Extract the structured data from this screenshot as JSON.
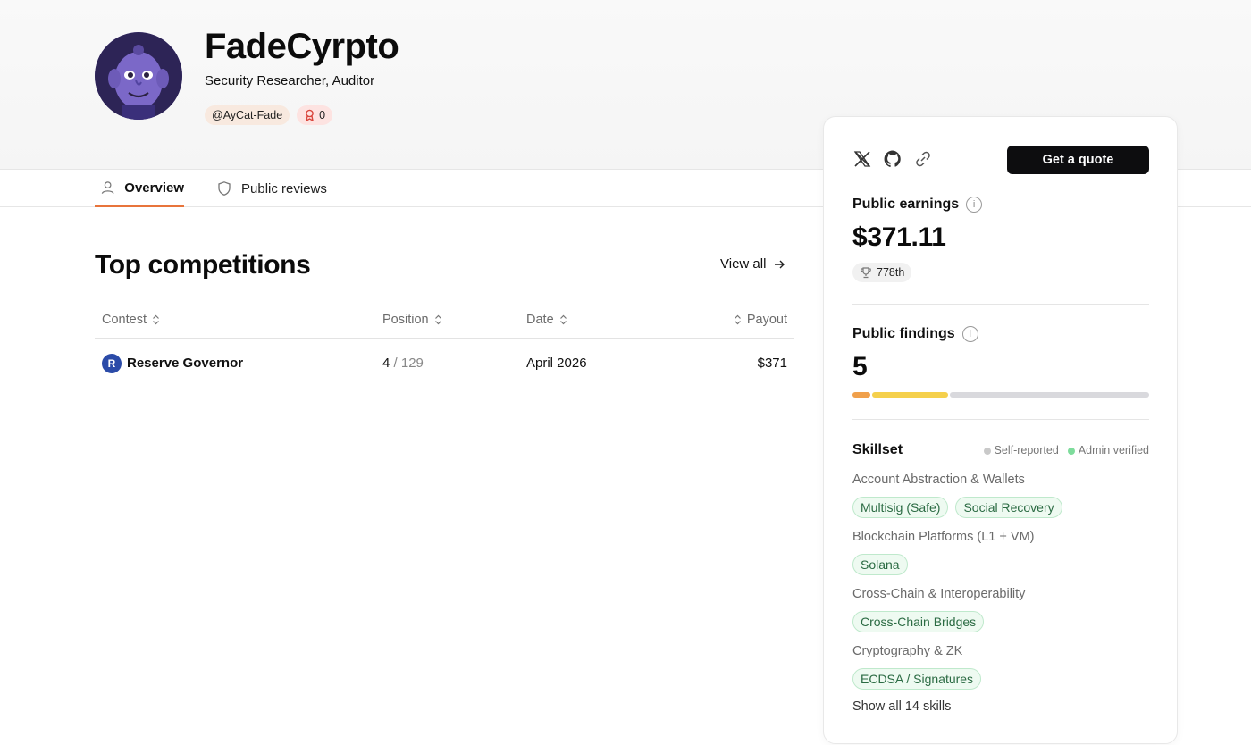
{
  "profile": {
    "name": "FadeCyrpto",
    "role": "Security Researcher, Auditor",
    "handle": "@AyCat-Fade",
    "awards": "0"
  },
  "tabs": [
    {
      "label": "Overview",
      "icon": "user-icon",
      "active": true
    },
    {
      "label": "Public reviews",
      "icon": "shield-icon",
      "active": false
    }
  ],
  "competitions": {
    "title": "Top competitions",
    "view_all": "View all",
    "columns": {
      "contest": "Contest",
      "position": "Position",
      "date": "Date",
      "payout": "Payout"
    },
    "rows": [
      {
        "logo": "R",
        "contest": "Reserve Governor",
        "position": "4",
        "total": "/ 129",
        "date": "April 2026",
        "payout": "$371"
      }
    ]
  },
  "sidebar": {
    "quote_button": "Get a quote",
    "earnings_label": "Public earnings",
    "earnings_value": "$371.11",
    "rank": "778th",
    "findings_label": "Public findings",
    "findings_value": "5",
    "findings_bar": [
      {
        "color": "#f0a04b",
        "fraction": 0.06
      },
      {
        "color": "#f5d04c",
        "fraction": 0.26
      },
      {
        "color": "#d9d9dd",
        "fraction": 0.68
      }
    ],
    "skillset_title": "Skillset",
    "legend_self": "Self-reported",
    "legend_admin": "Admin verified",
    "legend_colors": {
      "self": "#c9c9c9",
      "admin": "#7edc9c"
    },
    "skill_groups": [
      {
        "category": "Account Abstraction & Wallets",
        "skills": [
          "Multisig (Safe)",
          "Social Recovery"
        ]
      },
      {
        "category": "Blockchain Platforms (L1 + VM)",
        "skills": [
          "Solana"
        ]
      },
      {
        "category": "Cross-Chain & Interoperability",
        "skills": [
          "Cross-Chain Bridges"
        ]
      },
      {
        "category": "Cryptography & ZK",
        "skills": [
          "ECDSA / Signatures"
        ]
      }
    ],
    "show_all": "Show all 14 skills"
  },
  "colors": {
    "accent": "#e8743b",
    "primary_button": "#0d0d0f"
  }
}
